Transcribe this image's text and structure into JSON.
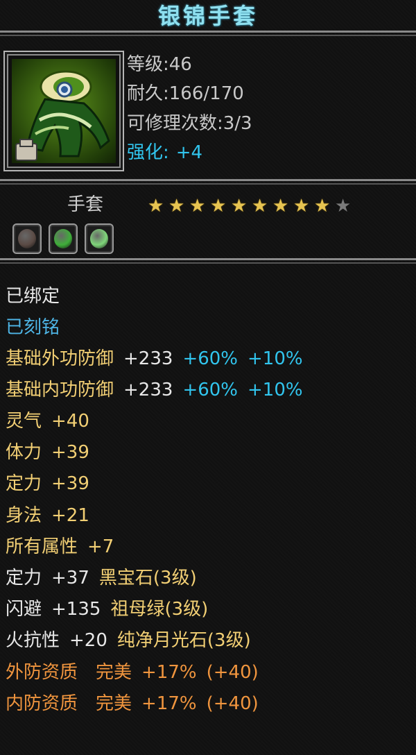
{
  "item": {
    "name": "银锦手套",
    "level": "等级:46",
    "durability": "耐久:166/170",
    "repairs": "可修理次数:3/3",
    "enhance_label": "强化:",
    "enhance_value": "+4",
    "type": "手套",
    "stars_total": 10,
    "stars_filled": 9,
    "sockets": [
      {
        "name": "black-gem-icon",
        "color": "#5a4a44"
      },
      {
        "name": "green-gem-icon",
        "color": "#3fae3a"
      },
      {
        "name": "moonstone-icon",
        "color": "#7fd67a"
      }
    ]
  },
  "status": {
    "bound": "已绑定",
    "engraved": "已刻铭"
  },
  "defense": [
    {
      "label": "基础外功防御",
      "value": "+233",
      "pct1": "+60%",
      "pct2": "+10%"
    },
    {
      "label": "基础内功防御",
      "value": "+233",
      "pct1": "+60%",
      "pct2": "+10%"
    }
  ],
  "attributes": [
    {
      "label": "灵气",
      "value": "+40"
    },
    {
      "label": "体力",
      "value": "+39"
    },
    {
      "label": "定力",
      "value": "+39"
    },
    {
      "label": "身法",
      "value": "+21"
    },
    {
      "label": "所有属性",
      "value": "+7"
    }
  ],
  "gem_bonuses": [
    {
      "label": "定力",
      "value": "+37",
      "gem": "黑宝石(3级)"
    },
    {
      "label": "闪避",
      "value": "+135",
      "gem": "祖母绿(3级)"
    },
    {
      "label": "火抗性",
      "value": "+20",
      "gem": "纯净月光石(3级)"
    }
  ],
  "qualities": [
    {
      "label": "外防资质",
      "grade": "完美",
      "pct": "+17%",
      "bonus": "(+40)"
    },
    {
      "label": "内防资质",
      "grade": "完美",
      "pct": "+17%",
      "bonus": "(+40)"
    }
  ],
  "colors": {
    "title": "#8fe0ef",
    "stat_gray": "#c9c9c9",
    "enhance_cyan": "#31c5ee",
    "attr_yellow": "#f2cf74",
    "quality_orange": "#f0953e",
    "star_gold": "#e7c451"
  }
}
